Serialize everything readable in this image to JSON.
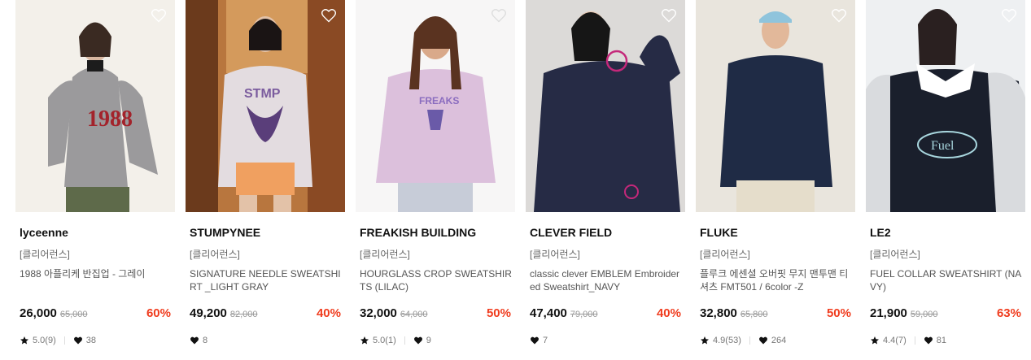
{
  "products": [
    {
      "brand": "lyceenne",
      "tag": "[클리어런스]",
      "name": "1988 아플리케 반집업 - 그레이",
      "price": "26,000",
      "original": "65,000",
      "discount": "60%",
      "rating": "5.0(9)",
      "likes": "38"
    },
    {
      "brand": "STUMPYNEE",
      "tag": "[클리어런스]",
      "name": "SIGNATURE NEEDLE SWEATSHIRT _LIGHT GRAY",
      "price": "49,200",
      "original": "82,000",
      "discount": "40%",
      "rating": "",
      "likes": "8"
    },
    {
      "brand": "FREAKISH BUILDING",
      "tag": "[클리어런스]",
      "name": "HOURGLASS CROP SWEATSHIRTS (LILAC)",
      "price": "32,000",
      "original": "64,000",
      "discount": "50%",
      "rating": "5.0(1)",
      "likes": "9"
    },
    {
      "brand": "CLEVER FIELD",
      "tag": "[클리어런스]",
      "name": "classic clever EMBLEM Embroidered Sweatshirt_NAVY",
      "price": "47,400",
      "original": "79,000",
      "discount": "40%",
      "rating": "",
      "likes": "7"
    },
    {
      "brand": "FLUKE",
      "tag": "[클리어런스]",
      "name": "플루크 에센셜 오버핏 무지 맨투맨 티셔츠 FMT501 / 6color -Z",
      "price": "32,800",
      "original": "65,800",
      "discount": "50%",
      "rating": "4.9(53)",
      "likes": "264"
    },
    {
      "brand": "LE2",
      "tag": "[클리어런스]",
      "name": "FUEL COLLAR SWEATSHIRT (NAVY)",
      "price": "21,900",
      "original": "59,000",
      "discount": "63%",
      "rating": "4.4(7)",
      "likes": "81"
    }
  ],
  "colors": {
    "discount": "#f03c1e",
    "price": "#111111",
    "muted": "#999999"
  },
  "icons": {
    "wishlist": "heart-outline-icon",
    "rating": "star-icon",
    "likes": "heart-filled-icon"
  }
}
